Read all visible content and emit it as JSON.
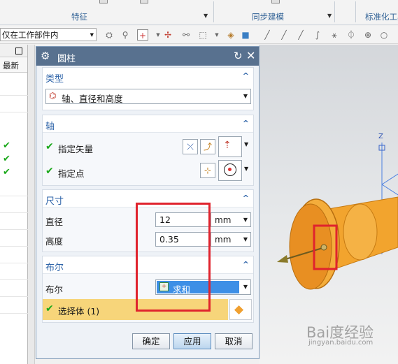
{
  "ribbon": {
    "groups": [
      {
        "label": "特征"
      },
      {
        "label": "同步建模"
      },
      {
        "label": "标准化工具"
      }
    ]
  },
  "selection_bar": {
    "filter_value": "仅在工作部件内"
  },
  "navigator": {
    "column_header": "最新"
  },
  "dialog": {
    "title": "圆柱",
    "type_section": {
      "title": "类型",
      "selected_type": "轴、直径和高度"
    },
    "axis_section": {
      "title": "轴",
      "specify_vector_label": "指定矢量",
      "specify_point_label": "指定点"
    },
    "dimension_section": {
      "title": "尺寸",
      "diameter_label": "直径",
      "diameter_value": "12",
      "diameter_unit": "mm",
      "height_label": "高度",
      "height_value": "0.35",
      "height_unit": "mm"
    },
    "boolean_section": {
      "title": "布尔",
      "boolean_label": "布尔",
      "boolean_value": "求和",
      "select_body_label": "选择体 (1)"
    },
    "buttons": {
      "ok": "确定",
      "apply": "应用",
      "cancel": "取消"
    }
  },
  "viewport": {
    "axis_label": "Z",
    "watermark_logo": "Bai度经验",
    "watermark_url": "jingyan.baidu.com"
  },
  "colors": {
    "title_bar": "#58718f",
    "section_header_text": "#2d63a8",
    "check_green": "#1aa81a",
    "highlight_yellow": "#f7d57a",
    "boolean_selected": "#3d8fe6",
    "cylinder_orange": "#f0a030",
    "annotation_red": "#e0232d"
  }
}
